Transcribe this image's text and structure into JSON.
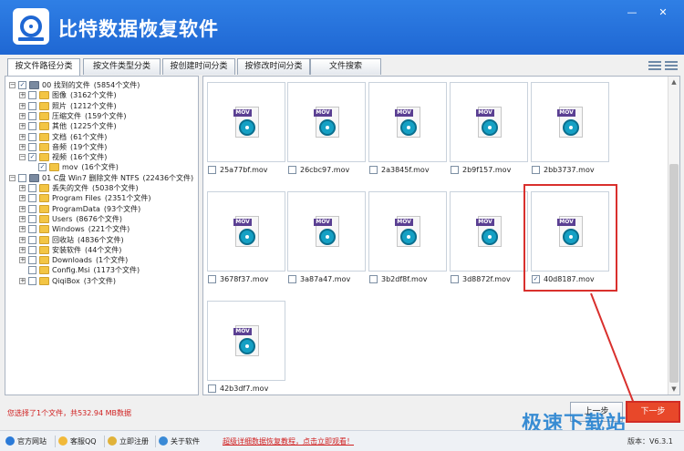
{
  "app": {
    "title": "比特数据恢复软件",
    "minimize": "—",
    "close": "✕"
  },
  "tabs": [
    "按文件路径分类",
    "按文件类型分类",
    "按创建时间分类",
    "按修改时间分类",
    "文件搜索"
  ],
  "tree": [
    {
      "label": "00 找到的文件",
      "count": "(5854个文件)",
      "level": 0,
      "expander": "−",
      "check": "✓",
      "icon": "drive-icon"
    },
    {
      "label": "图像",
      "count": "(3162个文件)",
      "level": 1,
      "expander": "+",
      "check": "",
      "icon": "folder-icon"
    },
    {
      "label": "照片",
      "count": "(1212个文件)",
      "level": 1,
      "expander": "+",
      "check": "",
      "icon": "folder-icon"
    },
    {
      "label": "压缩文件",
      "count": "(159个文件)",
      "level": 1,
      "expander": "+",
      "check": "",
      "icon": "folder-icon"
    },
    {
      "label": "其他",
      "count": "(1225个文件)",
      "level": 1,
      "expander": "+",
      "check": "",
      "icon": "folder-icon"
    },
    {
      "label": "文档",
      "count": "(61个文件)",
      "level": 1,
      "expander": "+",
      "check": "",
      "icon": "folder-icon"
    },
    {
      "label": "音频",
      "count": "(19个文件)",
      "level": 1,
      "expander": "+",
      "check": "",
      "icon": "folder-icon"
    },
    {
      "label": "视频",
      "count": "(16个文件)",
      "level": 1,
      "expander": "−",
      "check": "✓",
      "icon": "folder-icon"
    },
    {
      "label": "mov",
      "count": "(16个文件)",
      "level": 2,
      "expander": "",
      "check": "✓",
      "icon": "folder-icon"
    },
    {
      "label": "01 C盘 Win7 删除文件 NTFS",
      "count": "(22436个文件)",
      "level": 0,
      "expander": "−",
      "check": "",
      "icon": "drive-icon"
    },
    {
      "label": "丢失的文件",
      "count": "(5038个文件)",
      "level": 1,
      "expander": "+",
      "check": "",
      "icon": "folder-icon"
    },
    {
      "label": "Program Files",
      "count": "(2351个文件)",
      "level": 1,
      "expander": "+",
      "check": "",
      "icon": "folder-icon"
    },
    {
      "label": "ProgramData",
      "count": "(93个文件)",
      "level": 1,
      "expander": "+",
      "check": "",
      "icon": "folder-icon"
    },
    {
      "label": "Users",
      "count": "(8676个文件)",
      "level": 1,
      "expander": "+",
      "check": "",
      "icon": "folder-icon"
    },
    {
      "label": "Windows",
      "count": "(221个文件)",
      "level": 1,
      "expander": "+",
      "check": "",
      "icon": "folder-icon"
    },
    {
      "label": "回收站",
      "count": "(4836个文件)",
      "level": 1,
      "expander": "+",
      "check": "",
      "icon": "folder-icon"
    },
    {
      "label": "安装软件",
      "count": "(44个文件)",
      "level": 1,
      "expander": "+",
      "check": "",
      "icon": "folder-icon"
    },
    {
      "label": "Downloads",
      "count": "(1个文件)",
      "level": 1,
      "expander": "+",
      "check": "",
      "icon": "folder-icon"
    },
    {
      "label": "Config.Msi",
      "count": "(1173个文件)",
      "level": 1,
      "expander": "",
      "check": "",
      "icon": "folder-icon"
    },
    {
      "label": "QiqiBox",
      "count": "(3个文件)",
      "level": 1,
      "expander": "+",
      "check": "",
      "icon": "folder-icon"
    }
  ],
  "file_icon_tag": "MOV",
  "files": [
    {
      "name": "25a77bf.mov",
      "checked": ""
    },
    {
      "name": "26cbc97.mov",
      "checked": ""
    },
    {
      "name": "2a3845f.mov",
      "checked": ""
    },
    {
      "name": "2b9f157.mov",
      "checked": ""
    },
    {
      "name": "2bb3737.mov",
      "checked": ""
    },
    {
      "name": "3678f37.mov",
      "checked": ""
    },
    {
      "name": "3a87a47.mov",
      "checked": ""
    },
    {
      "name": "3b2df8f.mov",
      "checked": ""
    },
    {
      "name": "3d8872f.mov",
      "checked": ""
    },
    {
      "name": "40d8187.mov",
      "checked": "✓"
    },
    {
      "name": "42b3df7.mov",
      "checked": ""
    }
  ],
  "status": "您选择了1个文件，共532.94 MB数据",
  "buttons": {
    "prev": "上一步",
    "next": "下一步"
  },
  "footer": {
    "items": [
      "官方网站",
      "客服QQ",
      "立即注册",
      "关于软件"
    ],
    "promo": "超级详细数据恢复教程，点击立即观看！",
    "version_label": "版本：",
    "version": "V6.3.1"
  },
  "watermark": "极速下载站",
  "colors": {
    "header": "#1f67d3",
    "highlight": "#d9302d",
    "status_text": "#d02020",
    "next_button": "#e8482a"
  }
}
